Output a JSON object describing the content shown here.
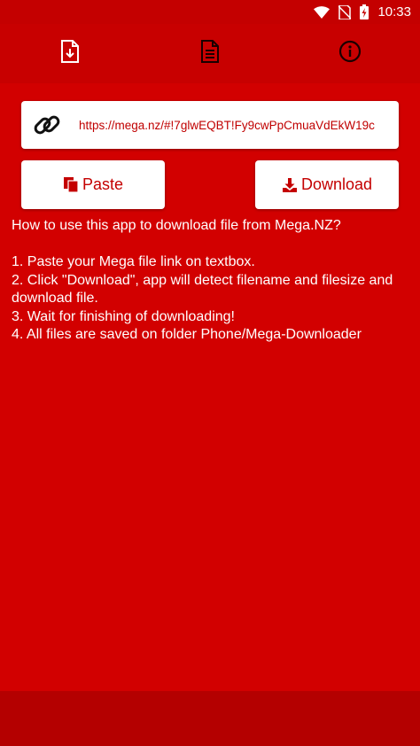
{
  "status_bar": {
    "time": "10:33",
    "icons": [
      "wifi-icon",
      "no-sim-icon",
      "battery-charging-icon"
    ]
  },
  "tabs": [
    {
      "icon": "file-download-icon"
    },
    {
      "icon": "document-icon"
    },
    {
      "icon": "info-icon"
    }
  ],
  "url_box": {
    "icon": "link-icon",
    "value": "https://mega.nz/#!7glwEQBT!Fy9cwPpCmuaVdEkW19c"
  },
  "buttons": {
    "paste_label": "Paste",
    "paste_icon": "clipboard-icon",
    "download_label": "Download",
    "download_icon": "download-tray-icon"
  },
  "instructions": {
    "heading": "How to use this app to download file from Mega.NZ?",
    "steps": [
      "1. Paste your Mega file link on textbox.",
      "2. Click \"Download\", app will detect filename and filesize and download file.",
      "3. Wait for finishing of downloading!",
      "4. All files are saved on folder Phone/Mega-Downloader"
    ]
  },
  "colors": {
    "background": "#d20000",
    "accent": "#c40000",
    "text_on_red": "#ffffff"
  }
}
